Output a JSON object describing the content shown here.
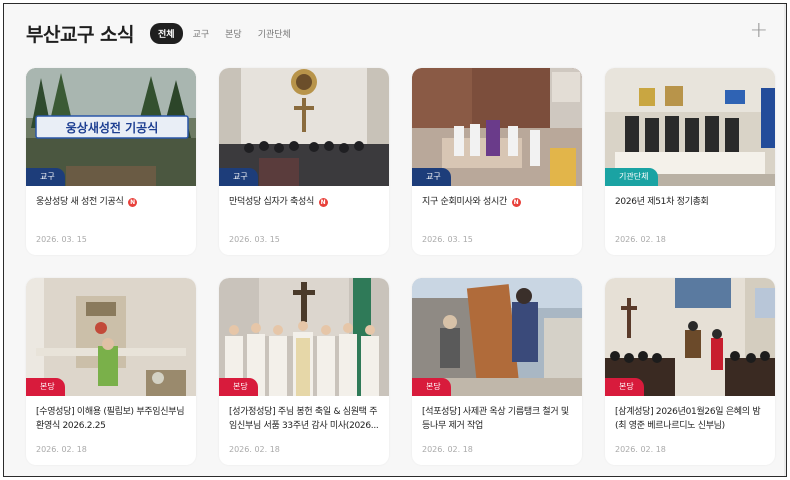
{
  "header": {
    "title": "부산교구 소식",
    "tabs": [
      "전체",
      "교구",
      "본당",
      "기관단체"
    ],
    "active_tab": 0,
    "add_icon": "plus-icon"
  },
  "colors": {
    "gyogu": "#1d3d7a",
    "bondang": "#d81b3c",
    "gigwan": "#1aa3a3",
    "new": "#e8413b"
  },
  "new_label": "N",
  "cards": [
    {
      "badge": "교구",
      "title": "웅상성당 새 성전 기공식",
      "is_new": true,
      "date": "2026. 03. 15",
      "banner": "웅상새성전 기공식"
    },
    {
      "badge": "교구",
      "title": "만덕성당 십자가 축성식",
      "is_new": true,
      "date": "2026. 03. 15"
    },
    {
      "badge": "교구",
      "title": "지구 순회미사와 성시간",
      "is_new": true,
      "date": "2026. 03. 15"
    },
    {
      "badge": "기관단체",
      "title": "2026년 제51차 정기총회",
      "is_new": false,
      "date": "2026. 02. 18"
    },
    {
      "badge": "본당",
      "title": "[수영성당] 이해용 (필립보) 부주임신부님 환영식 2026.2.25",
      "is_new": false,
      "date": "2026. 02. 18"
    },
    {
      "badge": "본당",
      "title": "[성가정성당] 주님 봉헌 축일 & 심원택 주임신부님 서품 33주년 감사 미사(2026...",
      "is_new": false,
      "date": "2026. 02. 18"
    },
    {
      "badge": "본당",
      "title": "[석포성당] 사제관 옥상 기름탱크 철거 및 등나무 제거 작업",
      "is_new": false,
      "date": "2026. 02. 18"
    },
    {
      "badge": "본당",
      "title": "[삼계성당] 2026년01월26일 은혜의 밤 (최 영준 베르나르디노 신부님)",
      "is_new": false,
      "date": "2026. 02. 18"
    }
  ]
}
